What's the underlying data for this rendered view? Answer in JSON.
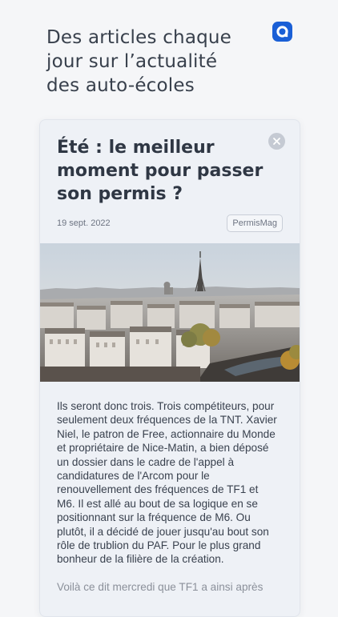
{
  "promo": {
    "headline_lines": [
      "Des articles chaque",
      "jour sur l’actualité",
      "des auto-écoles"
    ]
  },
  "brand": {
    "icon": "app-logo-icon",
    "color": "#1a5fd6"
  },
  "article": {
    "title_lines": [
      "Été : le meilleur",
      "moment pour passer",
      "son permis ?"
    ],
    "date": "19 sept. 2022",
    "source": "PermisMag",
    "image": "paris-skyline-eiffel-tower-photo",
    "body_lines": [
      "Ils seront donc trois. Trois compétiteurs, pour",
      "seulement deux fréquences de la TNT. Xavier",
      "Niel, le patron de Free, actionnaire du Monde",
      "et propriétaire de Nice-Matin, a bien déposé",
      "un dossier dans le cadre de l'appel à",
      "candidatures de l'Arcom pour le",
      "renouvellement des fréquences de TF1 et",
      "M6. Il est allé au bout de sa logique en se",
      "positionnant sur la fréquence de M6. Ou",
      "plutôt, il a décidé de jouer jusqu'au bout son",
      "rôle de trublion du PAF. Pour le plus grand",
      "bonheur de la filière de la création.",
      "",
      "Voilà ce dit mercredi que TF1 a ainsi après"
    ]
  },
  "controls": {
    "close_icon": "close-icon"
  }
}
